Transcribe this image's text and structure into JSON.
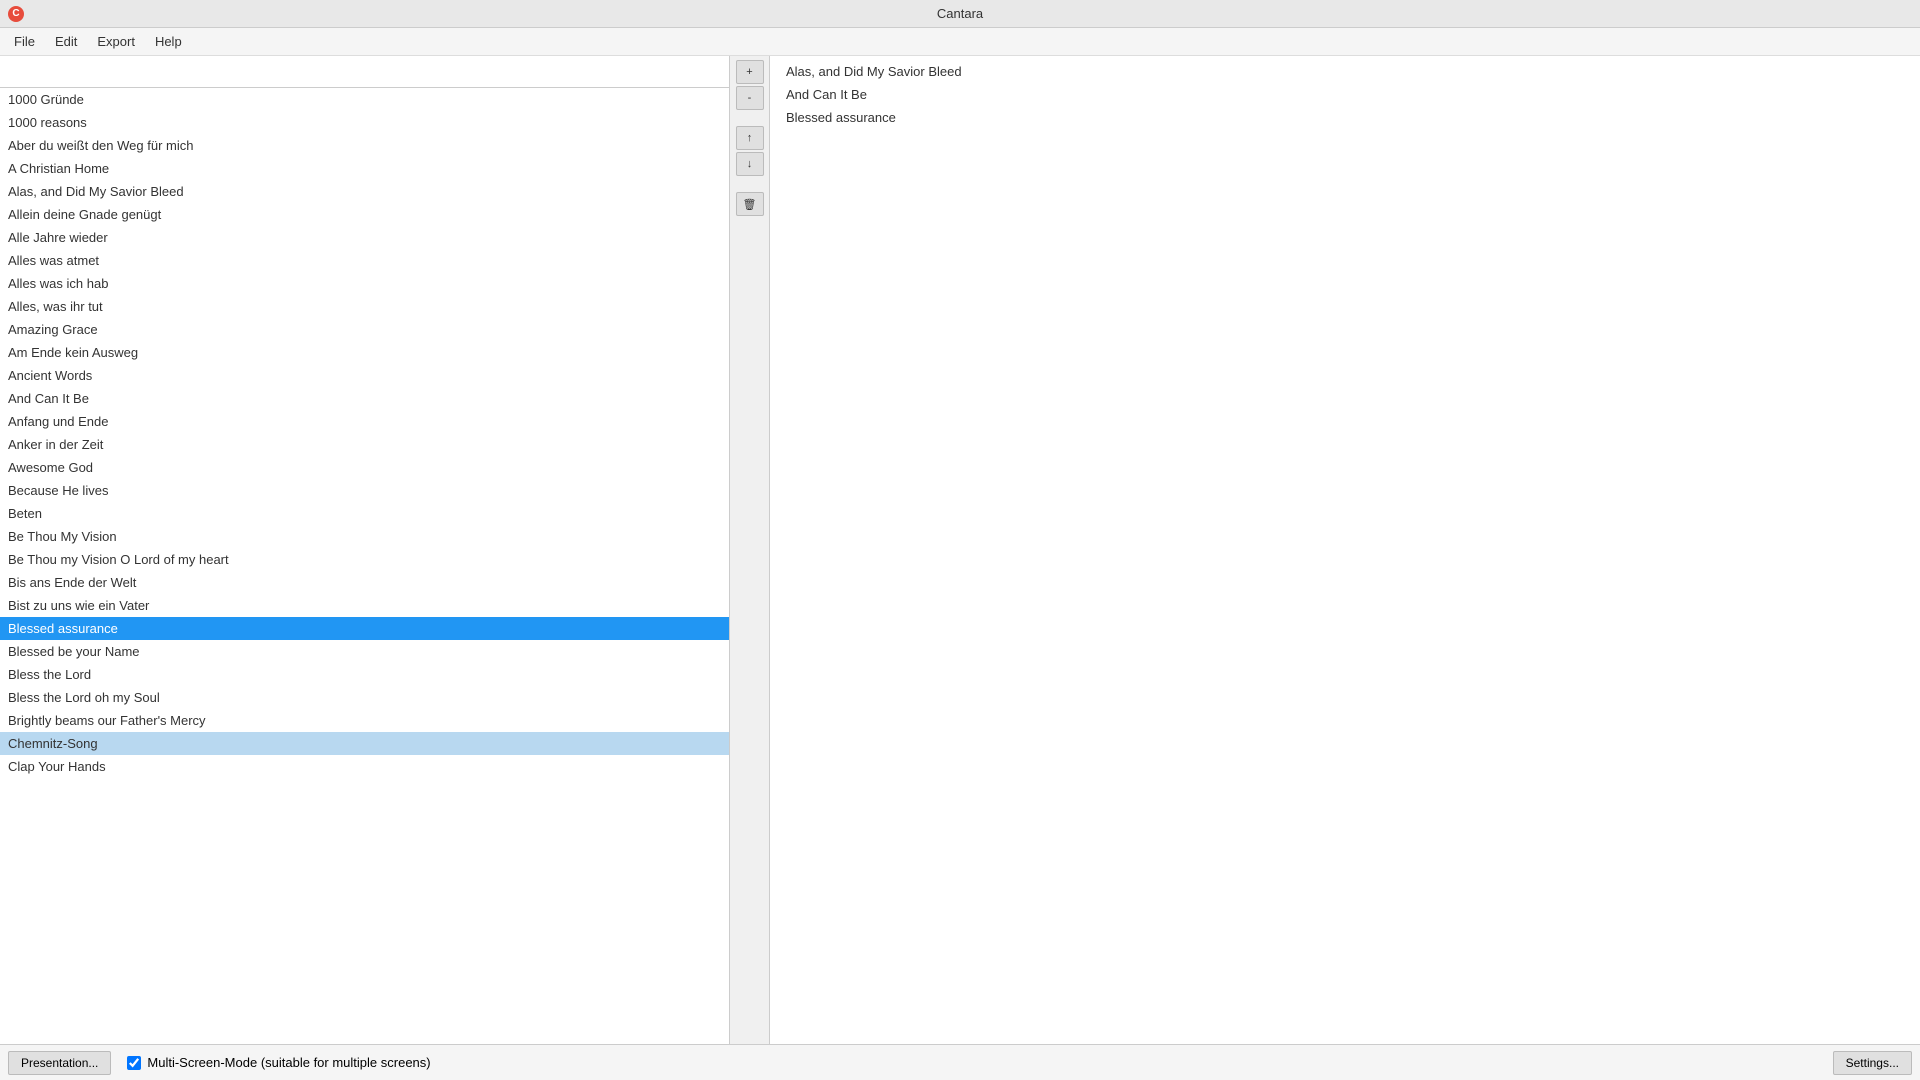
{
  "app": {
    "title": "Cantara",
    "icon": "C"
  },
  "menu": {
    "items": [
      "File",
      "Edit",
      "Export",
      "Help"
    ]
  },
  "search": {
    "placeholder": "",
    "value": ""
  },
  "songs": [
    {
      "label": "1000 Gründe"
    },
    {
      "label": "1000 reasons"
    },
    {
      "label": "Aber du weißt den Weg für mich"
    },
    {
      "label": "A Christian Home"
    },
    {
      "label": "Alas, and Did My Savior Bleed"
    },
    {
      "label": "Allein deine Gnade genügt"
    },
    {
      "label": "Alle Jahre wieder"
    },
    {
      "label": "Alles was atmet"
    },
    {
      "label": "Alles was ich hab"
    },
    {
      "label": "Alles, was ihr tut"
    },
    {
      "label": "Amazing Grace"
    },
    {
      "label": "Am Ende kein Ausweg"
    },
    {
      "label": "Ancient Words"
    },
    {
      "label": "And Can It Be"
    },
    {
      "label": "Anfang und Ende"
    },
    {
      "label": "Anker in der Zeit"
    },
    {
      "label": "Awesome God"
    },
    {
      "label": "Because He lives"
    },
    {
      "label": "Beten"
    },
    {
      "label": "Be Thou My Vision"
    },
    {
      "label": "Be Thou my Vision O Lord of my heart"
    },
    {
      "label": "Bis ans Ende der Welt"
    },
    {
      "label": "Bist zu uns wie ein Vater"
    },
    {
      "label": "Blessed assurance",
      "selected": true
    },
    {
      "label": "Blessed be your Name"
    },
    {
      "label": "Bless the Lord"
    },
    {
      "label": "Bless the Lord oh my Soul"
    },
    {
      "label": "Brightly beams our Father's Mercy"
    },
    {
      "label": "Chemnitz-Song",
      "hovered": true
    },
    {
      "label": "Clap Your Hands"
    }
  ],
  "controls": {
    "add": "+",
    "remove": "-",
    "up": "↑",
    "down": "↓",
    "delete": "🗑"
  },
  "playlist": {
    "items": [
      {
        "label": "Alas, and Did My Savior Bleed"
      },
      {
        "label": "And Can It Be"
      },
      {
        "label": "Blessed assurance"
      }
    ]
  },
  "statusbar": {
    "presentation_btn": "Presentation...",
    "multi_screen_label": "Multi-Screen-Mode (suitable for multiple screens)",
    "multi_screen_checked": true,
    "settings_btn": "Settings..."
  }
}
